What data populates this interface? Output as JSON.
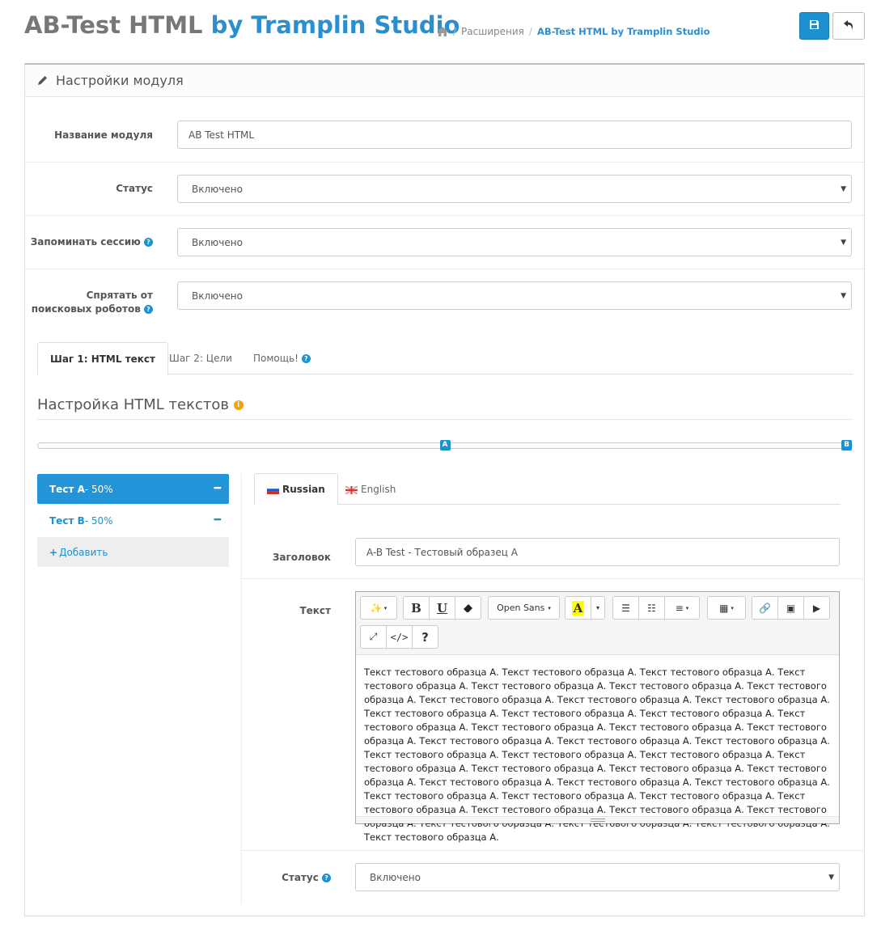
{
  "header": {
    "title_main": "AB-Test HTML",
    "title_accent": "by Tramplin Studio",
    "breadcrumb": {
      "item1": "Расширения",
      "current": "AB-Test HTML by Tramplin Studio"
    },
    "save_icon": "save-icon",
    "back_icon": "back-icon"
  },
  "panel": {
    "heading": "Настройки модуля",
    "fields": {
      "module_name": {
        "label": "Название модуля",
        "value": "AB Test HTML"
      },
      "status": {
        "label": "Статус",
        "value": "Включено"
      },
      "remember_session": {
        "label": "Запоминать сессию",
        "value": "Включено"
      },
      "hide_robots": {
        "label_line1": "Спрятать от",
        "label_line2": "поисковых роботов",
        "value": "Включено"
      }
    },
    "step_tabs": [
      "Шаг 1: HTML текст",
      "Шаг 2: Цели",
      "Помощь!"
    ],
    "section_title": "Настройка HTML текстов",
    "slider": {
      "handle_a": "A",
      "handle_b": "B",
      "a_position_fraction": 0.5,
      "b_position_fraction": 1.0
    },
    "tests": [
      {
        "name": "Тест А",
        "share": " - 50%"
      },
      {
        "name": "Тест В",
        "share": " - 50%"
      }
    ],
    "add_label": "Добавить",
    "lang_tabs": [
      "Russian",
      "English"
    ],
    "heading_field": {
      "label": "Заголовок",
      "value": "A-B Test - Тестовый образец А"
    },
    "text_field": {
      "label": "Текст",
      "font_dropdown": "Open Sans",
      "content": "Текст тестового образца А. Текст тестового образца А. Текст тестового образца А. Текст тестового образца А. Текст тестового образца А. Текст тестового образца А. Текст тестового образца А. Текст тестового образца А. Текст тестового образца А. Текст тестового образца А. Текст тестового образца А. Текст тестового образца А. Текст тестового образца А. Текст тестового образца А. Текст тестового образца А. Текст тестового образца А. Текст тестового образца А. Текст тестового образца А. Текст тестового образца А. Текст тестового образца А. Текст тестового образца А. Текст тестового образца А. Текст тестового образца А. Текст тестового образца А. Текст тестового образца А. Текст тестового образца А. Текст тестового образца А. Текст тестового образца А. Текст тестового образца А. Текст тестового образца А. Текст тестового образца А. Текст тестового образца А. Текст тестового образца А. Текст тестового образца А. Текст тестового образца А. Текст тестового образца А. Текст тестового образца А. Текст тестового образца А. Текст тестового образца А. Текст тестового образца А. Текст тестового образца А."
    },
    "variant_status": {
      "label": "Статус",
      "value": "Включено"
    }
  },
  "colors": {
    "accent": "#1e91cf",
    "active_item": "#2494d9",
    "info": "#f0a30a"
  }
}
